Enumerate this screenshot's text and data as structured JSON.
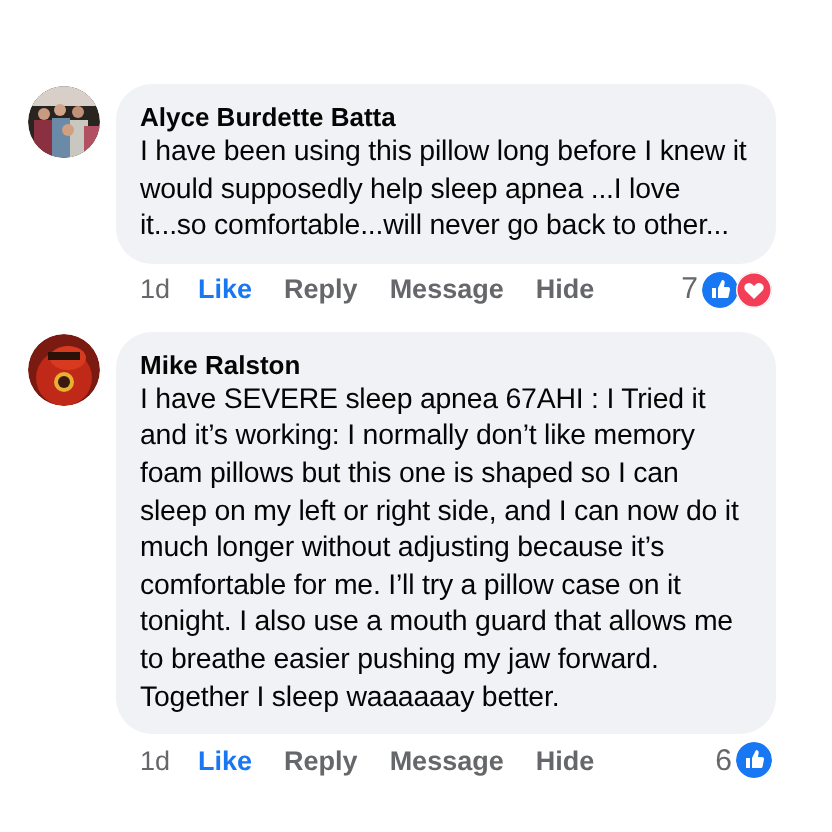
{
  "comments": [
    {
      "author": "Alyce Burdette Batta",
      "text": "I have been using this pillow long before I knew it would supposedly help sleep apnea ...I love it...so comfortable...will never go back to other...",
      "time": "1d",
      "actions": [
        {
          "label": "Like",
          "selected": true
        },
        {
          "label": "Reply",
          "selected": false
        },
        {
          "label": "Message",
          "selected": false
        },
        {
          "label": "Hide",
          "selected": false
        }
      ],
      "reaction_count": "7",
      "reactions": [
        {
          "kind": "like"
        },
        {
          "kind": "love"
        }
      ],
      "avatar": {
        "kind": "picture"
      }
    },
    {
      "author": "Mike Ralston",
      "text": "I have SEVERE sleep apnea 67AHI : I Tried it and it’s working: I normally don’t like memory foam pillows but this one is shaped so I can sleep on my left or right side, and I can now do it much longer without adjusting because it’s comfortable for me. I’ll try a pillow case on it tonight. I also use a mouth guard that allows me to breathe easier pushing my jaw forward. Together I sleep waaaaaay better.",
      "time": "1d",
      "actions": [
        {
          "label": "Like",
          "selected": true
        },
        {
          "label": "Reply",
          "selected": false
        },
        {
          "label": "Message",
          "selected": false
        },
        {
          "label": "Hide",
          "selected": false
        }
      ],
      "reaction_count": "6",
      "reactions": [
        {
          "kind": "like"
        }
      ],
      "avatar": {
        "kind": "picture"
      }
    }
  ]
}
